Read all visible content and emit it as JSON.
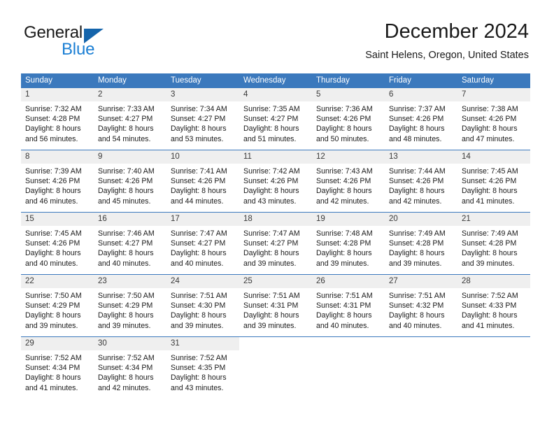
{
  "brand": {
    "name_part1": "General",
    "name_part2": "Blue",
    "triangle_color": "#1464ab",
    "accent_color": "#1b7fd4"
  },
  "header": {
    "title": "December 2024",
    "subtitle": "Saint Helens, Oregon, United States"
  },
  "theme": {
    "header_bg": "#3b79bd",
    "header_text": "#ffffff",
    "datebar_bg": "#efefef",
    "text": "#1a1a1a"
  },
  "weekdays": [
    "Sunday",
    "Monday",
    "Tuesday",
    "Wednesday",
    "Thursday",
    "Friday",
    "Saturday"
  ],
  "weeks": [
    [
      {
        "date": "1",
        "sunrise": "Sunrise: 7:32 AM",
        "sunset": "Sunset: 4:28 PM",
        "daylight1": "Daylight: 8 hours",
        "daylight2": "and 56 minutes."
      },
      {
        "date": "2",
        "sunrise": "Sunrise: 7:33 AM",
        "sunset": "Sunset: 4:27 PM",
        "daylight1": "Daylight: 8 hours",
        "daylight2": "and 54 minutes."
      },
      {
        "date": "3",
        "sunrise": "Sunrise: 7:34 AM",
        "sunset": "Sunset: 4:27 PM",
        "daylight1": "Daylight: 8 hours",
        "daylight2": "and 53 minutes."
      },
      {
        "date": "4",
        "sunrise": "Sunrise: 7:35 AM",
        "sunset": "Sunset: 4:27 PM",
        "daylight1": "Daylight: 8 hours",
        "daylight2": "and 51 minutes."
      },
      {
        "date": "5",
        "sunrise": "Sunrise: 7:36 AM",
        "sunset": "Sunset: 4:26 PM",
        "daylight1": "Daylight: 8 hours",
        "daylight2": "and 50 minutes."
      },
      {
        "date": "6",
        "sunrise": "Sunrise: 7:37 AM",
        "sunset": "Sunset: 4:26 PM",
        "daylight1": "Daylight: 8 hours",
        "daylight2": "and 48 minutes."
      },
      {
        "date": "7",
        "sunrise": "Sunrise: 7:38 AM",
        "sunset": "Sunset: 4:26 PM",
        "daylight1": "Daylight: 8 hours",
        "daylight2": "and 47 minutes."
      }
    ],
    [
      {
        "date": "8",
        "sunrise": "Sunrise: 7:39 AM",
        "sunset": "Sunset: 4:26 PM",
        "daylight1": "Daylight: 8 hours",
        "daylight2": "and 46 minutes."
      },
      {
        "date": "9",
        "sunrise": "Sunrise: 7:40 AM",
        "sunset": "Sunset: 4:26 PM",
        "daylight1": "Daylight: 8 hours",
        "daylight2": "and 45 minutes."
      },
      {
        "date": "10",
        "sunrise": "Sunrise: 7:41 AM",
        "sunset": "Sunset: 4:26 PM",
        "daylight1": "Daylight: 8 hours",
        "daylight2": "and 44 minutes."
      },
      {
        "date": "11",
        "sunrise": "Sunrise: 7:42 AM",
        "sunset": "Sunset: 4:26 PM",
        "daylight1": "Daylight: 8 hours",
        "daylight2": "and 43 minutes."
      },
      {
        "date": "12",
        "sunrise": "Sunrise: 7:43 AM",
        "sunset": "Sunset: 4:26 PM",
        "daylight1": "Daylight: 8 hours",
        "daylight2": "and 42 minutes."
      },
      {
        "date": "13",
        "sunrise": "Sunrise: 7:44 AM",
        "sunset": "Sunset: 4:26 PM",
        "daylight1": "Daylight: 8 hours",
        "daylight2": "and 42 minutes."
      },
      {
        "date": "14",
        "sunrise": "Sunrise: 7:45 AM",
        "sunset": "Sunset: 4:26 PM",
        "daylight1": "Daylight: 8 hours",
        "daylight2": "and 41 minutes."
      }
    ],
    [
      {
        "date": "15",
        "sunrise": "Sunrise: 7:45 AM",
        "sunset": "Sunset: 4:26 PM",
        "daylight1": "Daylight: 8 hours",
        "daylight2": "and 40 minutes."
      },
      {
        "date": "16",
        "sunrise": "Sunrise: 7:46 AM",
        "sunset": "Sunset: 4:27 PM",
        "daylight1": "Daylight: 8 hours",
        "daylight2": "and 40 minutes."
      },
      {
        "date": "17",
        "sunrise": "Sunrise: 7:47 AM",
        "sunset": "Sunset: 4:27 PM",
        "daylight1": "Daylight: 8 hours",
        "daylight2": "and 40 minutes."
      },
      {
        "date": "18",
        "sunrise": "Sunrise: 7:47 AM",
        "sunset": "Sunset: 4:27 PM",
        "daylight1": "Daylight: 8 hours",
        "daylight2": "and 39 minutes."
      },
      {
        "date": "19",
        "sunrise": "Sunrise: 7:48 AM",
        "sunset": "Sunset: 4:28 PM",
        "daylight1": "Daylight: 8 hours",
        "daylight2": "and 39 minutes."
      },
      {
        "date": "20",
        "sunrise": "Sunrise: 7:49 AM",
        "sunset": "Sunset: 4:28 PM",
        "daylight1": "Daylight: 8 hours",
        "daylight2": "and 39 minutes."
      },
      {
        "date": "21",
        "sunrise": "Sunrise: 7:49 AM",
        "sunset": "Sunset: 4:28 PM",
        "daylight1": "Daylight: 8 hours",
        "daylight2": "and 39 minutes."
      }
    ],
    [
      {
        "date": "22",
        "sunrise": "Sunrise: 7:50 AM",
        "sunset": "Sunset: 4:29 PM",
        "daylight1": "Daylight: 8 hours",
        "daylight2": "and 39 minutes."
      },
      {
        "date": "23",
        "sunrise": "Sunrise: 7:50 AM",
        "sunset": "Sunset: 4:29 PM",
        "daylight1": "Daylight: 8 hours",
        "daylight2": "and 39 minutes."
      },
      {
        "date": "24",
        "sunrise": "Sunrise: 7:51 AM",
        "sunset": "Sunset: 4:30 PM",
        "daylight1": "Daylight: 8 hours",
        "daylight2": "and 39 minutes."
      },
      {
        "date": "25",
        "sunrise": "Sunrise: 7:51 AM",
        "sunset": "Sunset: 4:31 PM",
        "daylight1": "Daylight: 8 hours",
        "daylight2": "and 39 minutes."
      },
      {
        "date": "26",
        "sunrise": "Sunrise: 7:51 AM",
        "sunset": "Sunset: 4:31 PM",
        "daylight1": "Daylight: 8 hours",
        "daylight2": "and 40 minutes."
      },
      {
        "date": "27",
        "sunrise": "Sunrise: 7:51 AM",
        "sunset": "Sunset: 4:32 PM",
        "daylight1": "Daylight: 8 hours",
        "daylight2": "and 40 minutes."
      },
      {
        "date": "28",
        "sunrise": "Sunrise: 7:52 AM",
        "sunset": "Sunset: 4:33 PM",
        "daylight1": "Daylight: 8 hours",
        "daylight2": "and 41 minutes."
      }
    ],
    [
      {
        "date": "29",
        "sunrise": "Sunrise: 7:52 AM",
        "sunset": "Sunset: 4:34 PM",
        "daylight1": "Daylight: 8 hours",
        "daylight2": "and 41 minutes."
      },
      {
        "date": "30",
        "sunrise": "Sunrise: 7:52 AM",
        "sunset": "Sunset: 4:34 PM",
        "daylight1": "Daylight: 8 hours",
        "daylight2": "and 42 minutes."
      },
      {
        "date": "31",
        "sunrise": "Sunrise: 7:52 AM",
        "sunset": "Sunset: 4:35 PM",
        "daylight1": "Daylight: 8 hours",
        "daylight2": "and 43 minutes."
      },
      {
        "date": "",
        "sunrise": "",
        "sunset": "",
        "daylight1": "",
        "daylight2": ""
      },
      {
        "date": "",
        "sunrise": "",
        "sunset": "",
        "daylight1": "",
        "daylight2": ""
      },
      {
        "date": "",
        "sunrise": "",
        "sunset": "",
        "daylight1": "",
        "daylight2": ""
      },
      {
        "date": "",
        "sunrise": "",
        "sunset": "",
        "daylight1": "",
        "daylight2": ""
      }
    ]
  ]
}
